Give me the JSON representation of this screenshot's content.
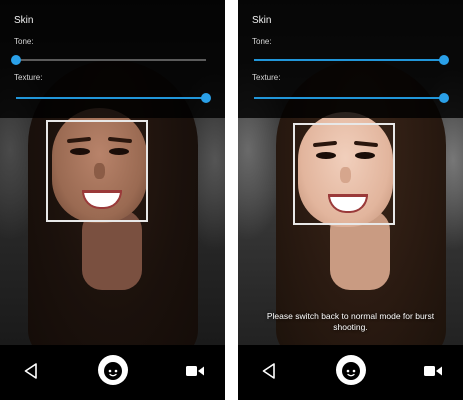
{
  "screens": [
    {
      "settings": {
        "title": "Skin",
        "tone_label": "Tone:",
        "texture_label": "Texture:",
        "tone_value": 0.0,
        "texture_value": 1.0
      },
      "toast": null
    },
    {
      "settings": {
        "title": "Skin",
        "tone_label": "Tone:",
        "texture_label": "Texture:",
        "tone_value": 1.0,
        "texture_value": 1.0
      },
      "toast": "Please switch back to normal mode for burst shooting."
    }
  ],
  "nav": {
    "back_icon": "back-triangle-icon",
    "shutter_icon": "beauty-face-shutter-icon",
    "video_icon": "video-camera-icon"
  },
  "colors": {
    "accent": "#2196d9",
    "face_box": "#e8e8e8",
    "background": "#000000"
  }
}
